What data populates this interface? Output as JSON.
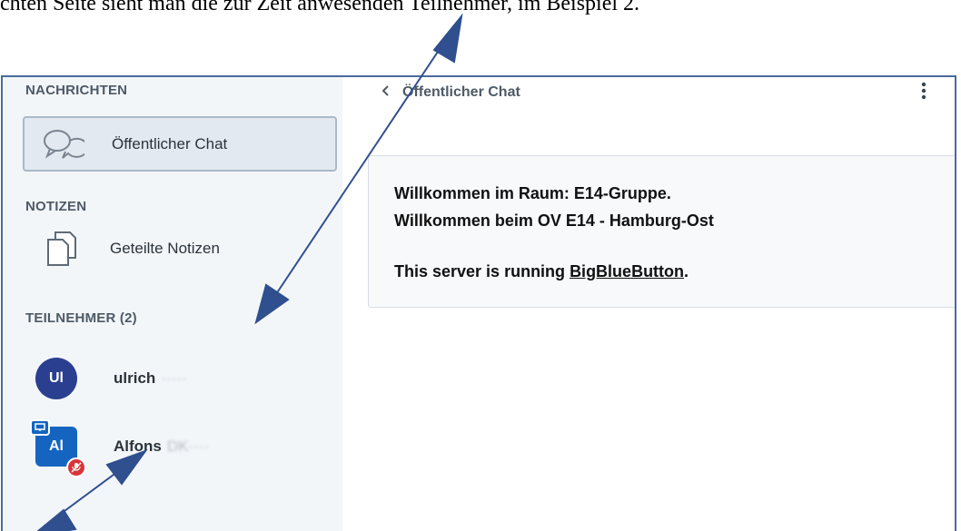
{
  "caption": "chten Seite sieht man die zur Zeit anwesenden Teilnehmer, im Beispiel 2.",
  "sidebar": {
    "messages_title": "NACHRICHTEN",
    "public_chat_label": "Öffentlicher Chat",
    "notes_title": "NOTIZEN",
    "shared_notes_label": "Geteilte Notizen",
    "participants_title": "TEILNEHMER (2)",
    "users": [
      {
        "initials": "Ul",
        "name": "ulrich",
        "name_blurred": "·····"
      },
      {
        "initials": "Al",
        "name": "Alfons",
        "name_blurred": "DK····"
      }
    ]
  },
  "chat": {
    "title": "Öffentlicher Chat",
    "welcome_line1": "Willkommen im Raum: E14-Gruppe.",
    "welcome_line2": "Willkommen beim OV E14 - Hamburg-Ost",
    "server_text": "This server is running ",
    "server_link": "BigBlueButton",
    "server_end": "."
  },
  "colors": {
    "annotation_arrow": "#2f4f8f",
    "frame_border": "#4a6a9c",
    "avatar_ulrich": "#2a3f8f",
    "avatar_alfons": "#1565c0",
    "mute_badge": "#d9343a"
  }
}
